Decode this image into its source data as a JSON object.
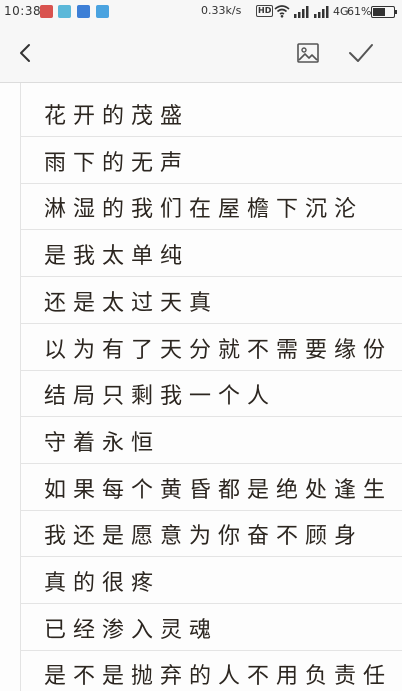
{
  "status_bar": {
    "time": "10:38",
    "net_speed": "0.33k/s",
    "hd_label": "HD",
    "network": "4G",
    "battery_percent": "61%",
    "battery_level": 0.61,
    "notification_colors": [
      "#d9534f",
      "#5bb8d9",
      "#3d7fd6",
      "#4aa3e0"
    ]
  },
  "toolbar": {
    "back_icon": "back-chevron-icon",
    "image_icon": "insert-image-icon",
    "confirm_icon": "checkmark-icon"
  },
  "note": {
    "lines": [
      "花开的茂盛",
      "雨下的无声",
      "淋湿的我们在屋檐下沉沦",
      "是我太单纯",
      "还是太过天真",
      "以为有了天分就不需要缘份",
      "结局只剩我一个人",
      "守着永恒",
      "如果每个黄昏都是绝处逢生",
      "我还是愿意为你奋不顾身",
      "真的很疼",
      "已经渗入灵魂",
      "是不是抛弃的人不用负责任"
    ]
  }
}
